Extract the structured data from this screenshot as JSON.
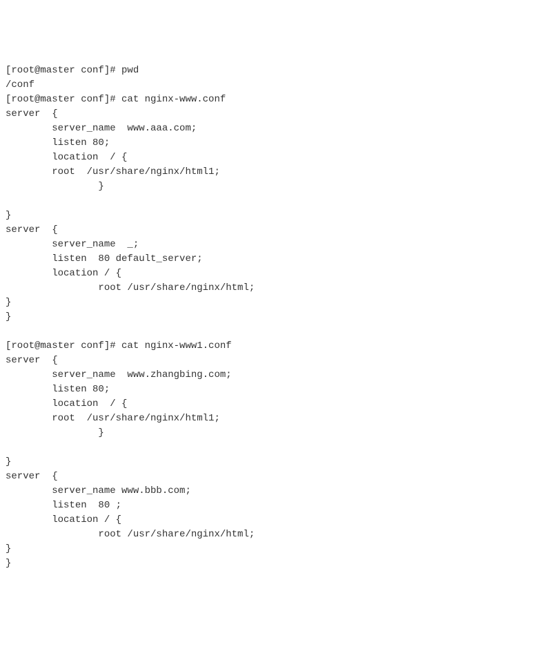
{
  "lines": [
    "[root@master conf]# pwd",
    "/conf",
    "[root@master conf]# cat nginx-www.conf",
    "server  {",
    "        server_name  www.aaa.com;",
    "        listen 80;",
    "        location  / {",
    "        root  /usr/share/nginx/html1;",
    "                }",
    "",
    "}",
    "server  {",
    "        server_name  _;",
    "        listen  80 default_server;",
    "        location / {",
    "                root /usr/share/nginx/html;",
    "}",
    "}",
    "",
    "[root@master conf]# cat nginx-www1.conf",
    "server  {",
    "        server_name  www.zhangbing.com;",
    "        listen 80;",
    "        location  / {",
    "        root  /usr/share/nginx/html1;",
    "                }",
    "",
    "}",
    "server  {",
    "        server_name www.bbb.com;",
    "        listen  80 ;",
    "        location / {",
    "                root /usr/share/nginx/html;",
    "}",
    "}"
  ]
}
